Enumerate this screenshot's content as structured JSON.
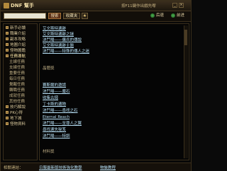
{
  "window": {
    "title": "DNF 幫手",
    "hint": "按F11鍵作出戲先嚟"
  },
  "toolbar": {
    "search_placeholder": "",
    "search_button": "搜索",
    "favorites_button": "收藏夹",
    "back_button": "后退",
    "forward_button": "前进"
  },
  "sidebar": {
    "items": [
      {
        "label": "新手必讀",
        "type": "folder"
      },
      {
        "label": "職業介紹",
        "type": "folder"
      },
      {
        "label": "副本攻略",
        "type": "folder"
      },
      {
        "label": "地圖介紹",
        "type": "folder"
      },
      {
        "label": "怪物圖鑑",
        "type": "folder"
      },
      {
        "label": "任務導航",
        "type": "folder"
      },
      {
        "label": "主線任務",
        "type": "sub"
      },
      {
        "label": "支線任務",
        "type": "sub"
      },
      {
        "label": "重要任務",
        "type": "sub"
      },
      {
        "label": "每日任務",
        "type": "sub"
      },
      {
        "label": "覺醒任務",
        "type": "sub"
      },
      {
        "label": "轉職任務",
        "type": "sub"
      },
      {
        "label": "成就任務",
        "type": "sub"
      },
      {
        "label": "其他任務",
        "type": "sub"
      },
      {
        "label": "技巧解說",
        "type": "folder"
      },
      {
        "label": "PK心得",
        "type": "folder"
      },
      {
        "label": "地下城",
        "type": "folder"
      },
      {
        "label": "怪物資料",
        "type": "folder"
      }
    ]
  },
  "content": {
    "links_top": [
      "艾文斯特遺跡",
      "艾文斯特遺跡之謎",
      "決鬥場——傭兵的傳說",
      "艾文斯特遺跡主題",
      "決鬥場——特殊的傳人之迷"
    ],
    "section_1": "晶體獎",
    "links_mid": [
      "賽斯爾的邀請",
      "決鬥場——魔石",
      "收集古錢",
      "丁卡斯的遺物",
      "決鬥場——尋找之石",
      "Eternal Reach",
      "決鬥場——至尊人之翼",
      "尋找遺失秘笈",
      "決鬥場——特訓"
    ],
    "section_2": "材料獎"
  },
  "statusbar": {
    "label": "相關連結：",
    "link1": "日服最新版技術強化教學",
    "link2": "物裝教程"
  }
}
